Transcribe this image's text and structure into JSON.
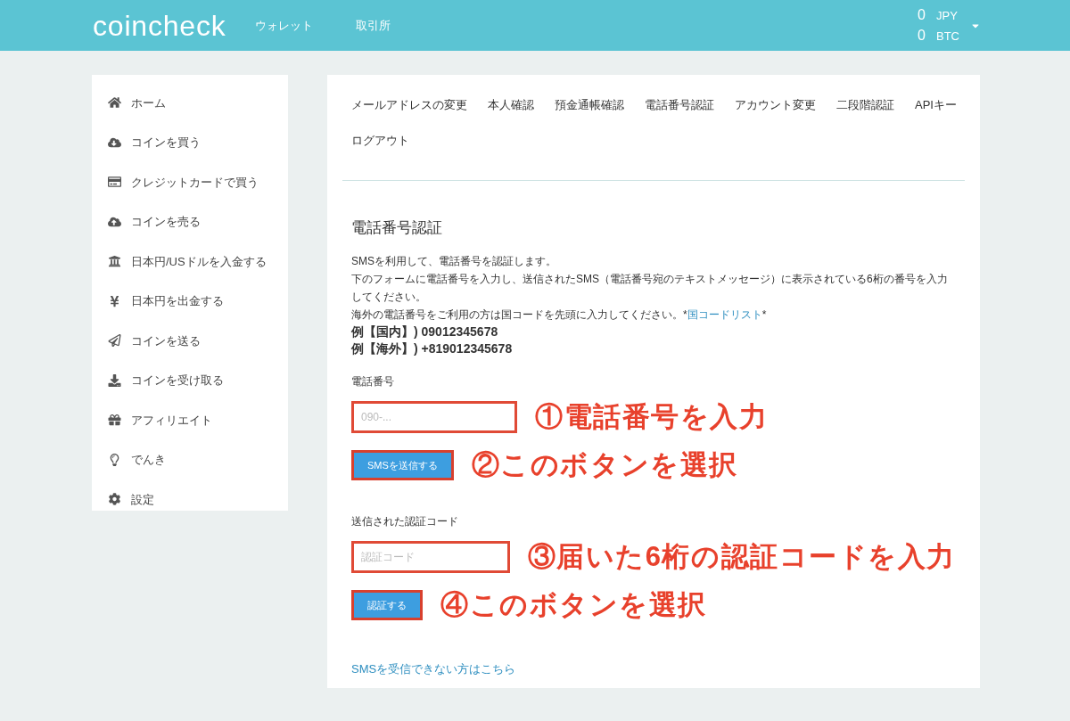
{
  "header": {
    "logo": "coincheck",
    "nav": [
      "ウォレット",
      "取引所"
    ],
    "balances": [
      {
        "amount": "0",
        "currency": "JPY"
      },
      {
        "amount": "0",
        "currency": "BTC"
      }
    ]
  },
  "sidebar": {
    "items": [
      "ホーム",
      "コインを買う",
      "クレジットカードで買う",
      "コインを売る",
      "日本円/USドルを入金する",
      "日本円を出金する",
      "コインを送る",
      "コインを受け取る",
      "アフィリエイト",
      "でんき",
      "設定"
    ]
  },
  "tabs": [
    "メールアドレスの変更",
    "本人確認",
    "預金通帳確認",
    "電話番号認証",
    "アカウント変更",
    "二段階認証",
    "APIキー",
    "ログアウト"
  ],
  "section": {
    "title": "電話番号認証",
    "lines": [
      "SMSを利用して、電話番号を認証します。",
      "下のフォームに電話番号を入力し、送信されたSMS（電話番号宛のテキストメッセージ）に表示されている6桁の番号を入力してください。"
    ],
    "intl_note": "海外の電話番号をご利用の方は国コードを先頭に入力してください。*",
    "intl_link": "国コードリスト",
    "intl_after": "*",
    "examples": [
      "例【国内】) 09012345678",
      "例【海外】) +819012345678"
    ]
  },
  "form": [
    {
      "kind": "label",
      "text": "電話番号"
    },
    {
      "kind": "input",
      "placeholder": "090-...",
      "annotation": "①電話番号を入力"
    },
    {
      "kind": "button",
      "text": "SMSを送信する",
      "annotation": "②このボタンを選択"
    },
    {
      "kind": "label",
      "text": "送信された認証コード"
    },
    {
      "kind": "input",
      "placeholder": "認証コード",
      "annotation": "③届いた6桁の認証コードを入力"
    },
    {
      "kind": "button",
      "text": "認証する",
      "annotation": "④このボタンを選択"
    }
  ],
  "help_link": "SMSを受信できない方はこちら"
}
